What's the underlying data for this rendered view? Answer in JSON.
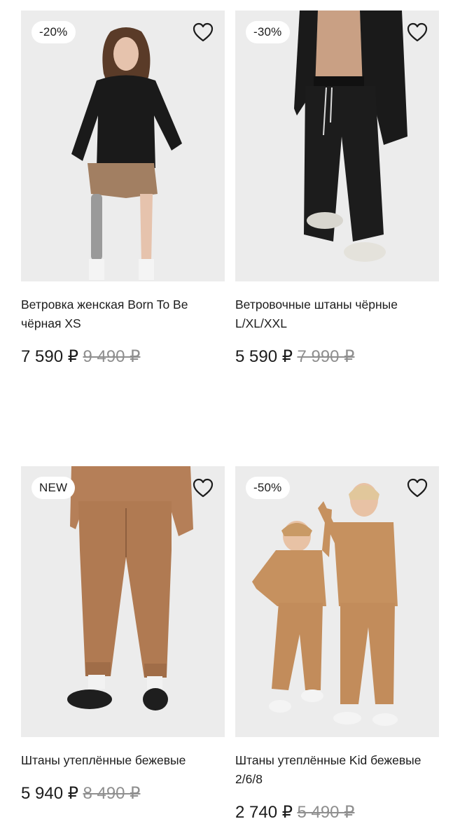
{
  "products": [
    {
      "badge": "-20%",
      "title": "Ветровка женская Born To Be чёрная XS",
      "price": "7 590 ₽",
      "old_price": "9 490 ₽",
      "image_alt": "Женщина в чёрной ветровке и бежевых шортах",
      "favorite_icon": "heart-outline-icon"
    },
    {
      "badge": "-30%",
      "title": "Ветровочные штаны чёрные L/XL/XXL",
      "price": "5 590 ₽",
      "old_price": "7 990 ₽",
      "image_alt": "Мужчина в чёрных ветровочных штанах",
      "favorite_icon": "heart-outline-icon"
    },
    {
      "badge": "NEW",
      "title": "Штаны утеплённые бежевые",
      "price": "5 940 ₽",
      "old_price": "8 490 ₽",
      "image_alt": "Бежевые утеплённые штаны, вид сзади",
      "favorite_icon": "heart-outline-icon"
    },
    {
      "badge": "-50%",
      "title": "Штаны утеплённые Kid бежевые 2/6/8",
      "price": "2 740 ₽",
      "old_price": "5 490 ₽",
      "image_alt": "Двое детей в бежевых костюмах",
      "favorite_icon": "heart-outline-icon"
    }
  ],
  "colors": {
    "text": "#1c1c1c",
    "old_price": "#8f8f8f",
    "photo_bg": "#ebebeb",
    "black_garment": "#1a1a1a",
    "beige_garment": "#b07c55"
  }
}
